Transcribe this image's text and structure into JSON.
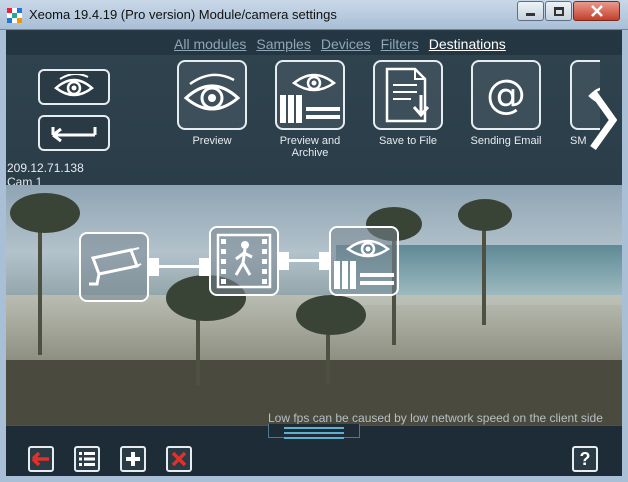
{
  "window": {
    "title": "Xeoma 19.4.19 (Pro version) Module/camera settings"
  },
  "tabs": [
    {
      "label": "All modules",
      "active": false
    },
    {
      "label": "Samples",
      "active": false
    },
    {
      "label": "Devices",
      "active": false
    },
    {
      "label": "Filters",
      "active": false
    },
    {
      "label": "Destinations",
      "active": true
    }
  ],
  "camera": {
    "ip": "209.12.71.138",
    "name": "Cam  1"
  },
  "modules": [
    {
      "label": "Preview",
      "icon": "eye-icon"
    },
    {
      "label": "Preview and Archive",
      "icon": "eye-archive-icon"
    },
    {
      "label": "Save to File",
      "icon": "save-file-icon"
    },
    {
      "label": "Sending Email",
      "icon": "at-sign-icon"
    },
    {
      "label": "SM",
      "icon": "sms-icon"
    }
  ],
  "chain": [
    "camera-icon",
    "motion-detector-icon",
    "preview-archive-icon"
  ],
  "notices": {
    "fps": "Low fps can be caused by low network speed on the client side"
  },
  "help_label": "?",
  "colors": {
    "accent_red": "#e0302a",
    "tab_active": "#ffffff",
    "tab_inactive": "#8fa6b6",
    "handle_accent": "#5fb0cf"
  }
}
